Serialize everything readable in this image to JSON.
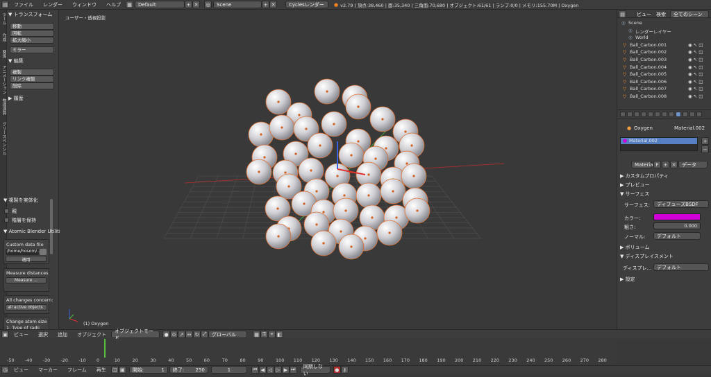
{
  "top": {
    "menus": [
      "ファイル",
      "レンダー",
      "ウィンドウ",
      "ヘルプ"
    ],
    "layout": "Default",
    "scene": "Scene",
    "engine": "Cyclesレンダー",
    "stats": "v2.79 | 頂点:38,460 | 面:35,340 | 三角面:70,680 | オブジェクト:61/61 | ランプ:0/0 | メモリ:155.70M | Oxygen"
  },
  "tools": {
    "transform_head": "▼ トランスフォーム",
    "move": "移動",
    "rotate": "回転",
    "scale": "拡大縮小",
    "mirror": "ミラー",
    "edit_head": "▼ 編集",
    "duplicate": "複製",
    "link_dup": "リンク複製",
    "delete": "削除",
    "history_head": "▶ 履歴",
    "tab1": "ツール",
    "tab2": "作成",
    "tab3": "関係",
    "tab4": "アニメーション",
    "tab5": "物理演算",
    "tab6": "グリースペンシル",
    "op_head": "▼ 複製を実体化",
    "op_check1": "親",
    "op_check2": "階層を保持",
    "atomic_head": "▼ Atomic Blender Utiliti",
    "custom_label": "Custom data file",
    "path": "/home/hosom/...",
    "apply": "適用",
    "measure_label": "Measure distances",
    "measure_btn": "Measure ...",
    "changes_label": "All changes concern:",
    "changes_value": "all active objects",
    "size_label": "Change atom size",
    "radii_label": "1. Type of radii"
  },
  "viewport": {
    "label": "ユーザー・透視投影",
    "status": "(1) Oxygen"
  },
  "viewheader": {
    "items": [
      "ビュー",
      "選択",
      "追加",
      "オブジェクト"
    ],
    "mode": "オブジェクトモード",
    "orient": "グローバル"
  },
  "outliner": {
    "tabs": [
      "ビュー",
      "検索",
      "全てのシーン"
    ],
    "rows": [
      "Scene",
      "レンダーレイヤー",
      "World",
      "Ball_Carbon.001",
      "Ball_Carbon.002",
      "Ball_Carbon.003",
      "Ball_Carbon.004",
      "Ball_Carbon.005",
      "Ball_Carbon.006",
      "Ball_Carbon.007",
      "Ball_Carbon.008"
    ]
  },
  "props": {
    "crumb1": "Oxygen",
    "crumb2": "Material.002",
    "slot": "Material.002",
    "matname": "Material",
    "f": "F",
    "data": "データ",
    "custom": "▶ カスタムプロパティ",
    "preview": "▶ プレビュー",
    "surface": "▼ サーフェス",
    "surface_label": "サーフェス:",
    "surface_value": "ディフューズBSDF",
    "color_label": "カラー:",
    "rough_label": "粗さ:",
    "rough_value": "0.000",
    "normal_label": "ノーマル:",
    "normal_value": "デフォルト",
    "volume": "▶ ボリューム",
    "disp": "▼ ディスプレイスメント",
    "disp_label": "ディスプレ...",
    "disp_value": "デフォルト",
    "settings": "▶ 設定",
    "color": "#d000d8"
  },
  "timeline": {
    "ticks": [
      "-50",
      "-40",
      "-30",
      "-20",
      "-10",
      "0",
      "10",
      "20",
      "30",
      "40",
      "50",
      "60",
      "70",
      "80",
      "90",
      "100",
      "110",
      "120",
      "130",
      "140",
      "150",
      "160",
      "170",
      "180",
      "190",
      "200",
      "210",
      "220",
      "230",
      "240",
      "250",
      "260",
      "270",
      "280"
    ]
  },
  "footer": {
    "items": [
      "ビュー",
      "マーカー",
      "フレーム",
      "再生"
    ],
    "start_label": "開始:",
    "start": "1",
    "end_label": "終了:",
    "end": "250",
    "current": "1",
    "sync": "同期しない"
  }
}
